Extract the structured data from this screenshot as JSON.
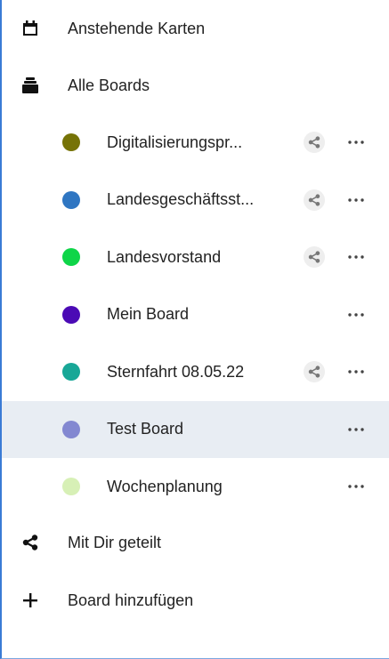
{
  "nav": {
    "upcoming_label": "Anstehende Karten",
    "all_boards_label": "Alle Boards",
    "shared_label": "Mit Dir geteilt",
    "add_board_label": "Board hinzufügen"
  },
  "boards": [
    {
      "label": "Digitalisierungspr...",
      "color": "#767307",
      "shared": true,
      "selected": false
    },
    {
      "label": "Landesgeschäftsst...",
      "color": "#2f76c2",
      "shared": true,
      "selected": false
    },
    {
      "label": "Landesvorstand",
      "color": "#0ed548",
      "shared": true,
      "selected": false
    },
    {
      "label": "Mein Board",
      "color": "#4b0ab5",
      "shared": false,
      "selected": false
    },
    {
      "label": "Sternfahrt 08.05.22",
      "color": "#18a797",
      "shared": true,
      "selected": false
    },
    {
      "label": "Test Board",
      "color": "#8388d1",
      "shared": false,
      "selected": true
    },
    {
      "label": "Wochenplanung",
      "color": "#d7f0b6",
      "shared": false,
      "selected": false
    }
  ],
  "icons": {
    "upcoming": "calendar-icon",
    "all_boards": "archive-icon",
    "shared": "share-icon",
    "add": "plus-icon",
    "board_share": "share-icon",
    "board_more": "more-icon"
  }
}
